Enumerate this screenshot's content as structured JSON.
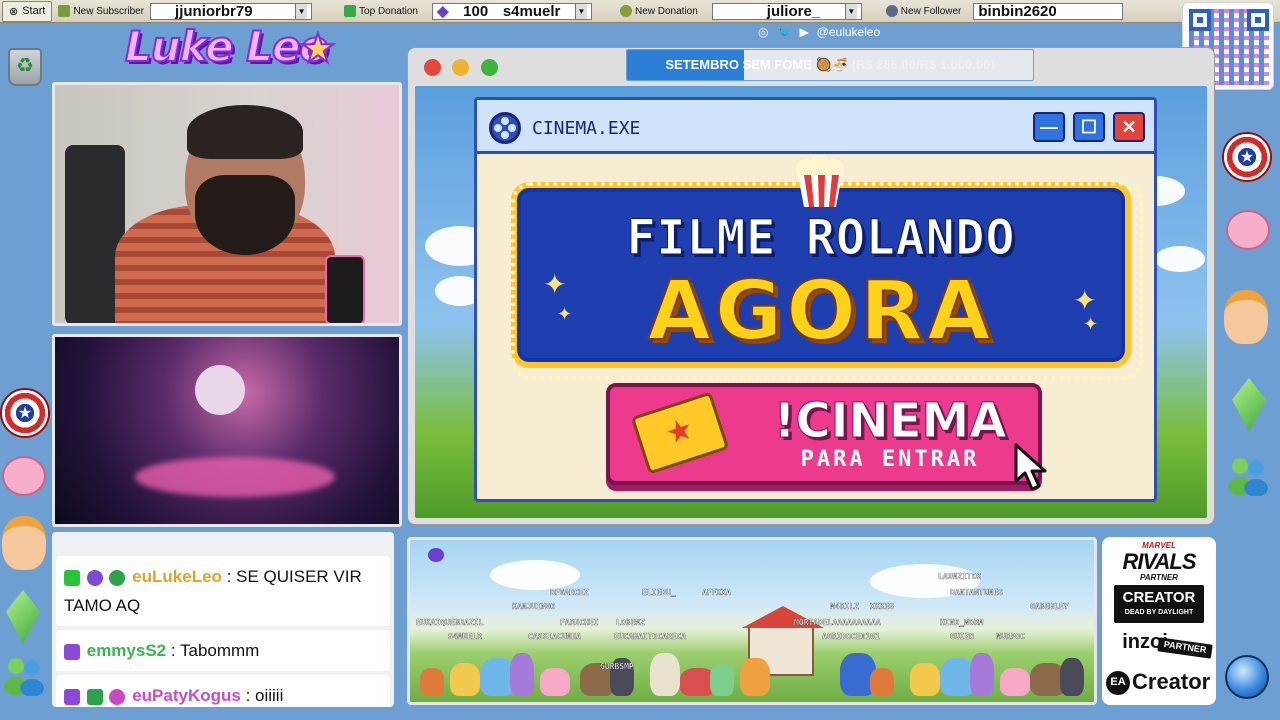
{
  "topbar": {
    "start": "Start",
    "new_subscriber_label": "New Subscriber",
    "new_subscriber_value": "jjuniorbr79",
    "top_donation_label": "Top Donation",
    "top_donation_amount": "100",
    "top_donation_user": "s4muelr",
    "new_donation_label": "New Donation",
    "new_donation_value": "juliore_",
    "new_follower_label": "New Follower",
    "new_follower_value": "binbin2620"
  },
  "logo": {
    "text": "Luke Leo"
  },
  "social": {
    "handle": "@eulukeleo"
  },
  "goal": {
    "title": "SETEMBRO SEM FOME",
    "emoji": "🥘🍜",
    "amount": "(R$ 288,00/R$ 1.000,00)",
    "progress": 0.288
  },
  "cinema": {
    "window_title": "CINEMA.EXE",
    "minimize": "—",
    "maximize": "☐",
    "close": "✕",
    "headline1": "FILME ROLANDO",
    "headline2": "AGORA",
    "button_main": "!CINEMA",
    "button_sub": "PARA ENTRAR"
  },
  "chat": {
    "messages": [
      {
        "user": "euLukeLeo",
        "text": " : SE QUISER VIR TAMO AQ",
        "color": "#e0a32a"
      },
      {
        "user": "emmysS2",
        "text": " : Tabommm",
        "color": "#36b84a"
      },
      {
        "user": "euPatyKogus",
        "text": " : oiiiii",
        "color": "#c94ac6"
      }
    ]
  },
  "pokemon_names": [
    "DFGARCEZ",
    "ELIEDU_",
    "AFFXXA",
    "LAUNZITOS",
    "DANTANTUNES",
    "KANJUINGO",
    "EUKAIQUEBRAZIL",
    "FARUCHEI",
    "LOBENZ",
    "M4RILZ",
    "XKKES",
    "GABEBLEY",
    "S4MUELR",
    "CASSIACUNHA",
    "EUCABAITOCARECA",
    "MORTADELAAAAAAAAAA",
    "HIND_WORM",
    "AGRIDOCE0101",
    "GUIZO",
    "MURPOC",
    "GURBSMP"
  ],
  "partner": {
    "marvel": "MARVEL",
    "rivals": "RIVALS",
    "rivals_partner": "PARTNER",
    "creator": "CREATOR",
    "dbd": "DEAD BY DAYLIGHT",
    "inzoi": "inzoi",
    "inzoi_partner": "PARTNER",
    "ea": "EA",
    "ea_creator": "Creator"
  },
  "colors": {
    "accent": "#2c4fb8",
    "pink": "#ec3b8d",
    "gold": "#ffc52a"
  }
}
